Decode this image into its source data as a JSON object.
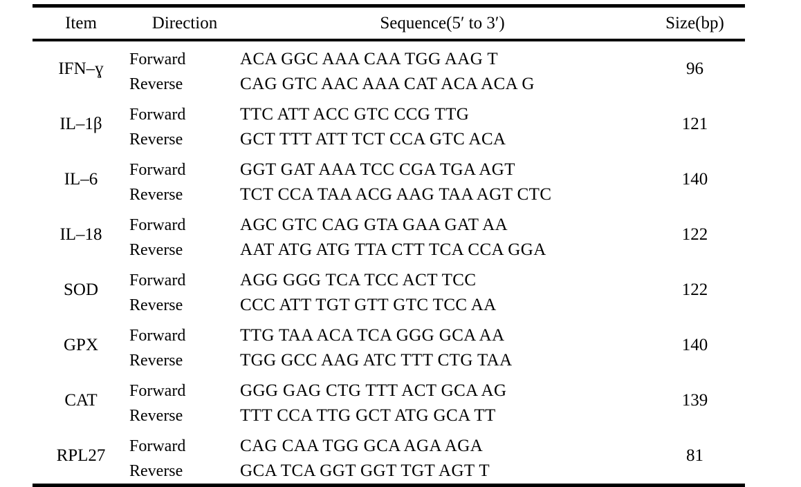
{
  "table": {
    "columns": [
      {
        "key": "item",
        "label": "Item"
      },
      {
        "key": "direction",
        "label": "Direction"
      },
      {
        "key": "sequence",
        "label": "Sequence(5′ to 3′)"
      },
      {
        "key": "size",
        "label": "Size(bp)"
      }
    ],
    "rows": [
      {
        "item": "IFN–ɣ",
        "size": "96",
        "forward_label": "Forward",
        "reverse_label": "Reverse",
        "forward_sequence": "ACA GGC AAA CAA TGG AAG T",
        "reverse_sequence": "CAG GTC AAC AAA CAT ACA ACA G"
      },
      {
        "item": "IL–1β",
        "size": "121",
        "forward_label": "Forward",
        "reverse_label": "Reverse",
        "forward_sequence": "TTC ATT ACC GTC CCG TTG",
        "reverse_sequence": "GCT TTT ATT TCT CCA GTC ACA"
      },
      {
        "item": "IL–6",
        "size": "140",
        "forward_label": "Forward",
        "reverse_label": "Reverse",
        "forward_sequence": "GGT GAT AAA TCC CGA TGA AGT",
        "reverse_sequence": "TCT CCA TAA ACG AAG TAA AGT CTC"
      },
      {
        "item": "IL–18",
        "size": "122",
        "forward_label": "Forward",
        "reverse_label": "Reverse",
        "forward_sequence": "AGC GTC CAG GTA GAA GAT AA",
        "reverse_sequence": "AAT ATG ATG TTA CTT TCA CCA GGA"
      },
      {
        "item": "SOD",
        "size": "122",
        "forward_label": "Forward",
        "reverse_label": "Reverse",
        "forward_sequence": "AGG GGG TCA TCC ACT TCC",
        "reverse_sequence": "CCC ATT TGT GTT GTC TCC AA"
      },
      {
        "item": "GPX",
        "size": "140",
        "forward_label": "Forward",
        "reverse_label": "Reverse",
        "forward_sequence": "TTG TAA ACA TCA GGG GCA AA",
        "reverse_sequence": "TGG GCC AAG ATC TTT CTG TAA"
      },
      {
        "item": "CAT",
        "size": "139",
        "forward_label": "Forward",
        "reverse_label": "Reverse",
        "forward_sequence": "GGG GAG CTG TTT ACT GCA AG",
        "reverse_sequence": "TTT CCA TTG GCT ATG GCA TT"
      },
      {
        "item": "RPL27",
        "size": "81",
        "forward_label": "Forward",
        "reverse_label": "Reverse",
        "forward_sequence": "CAG CAA TGG GCA AGA AGA",
        "reverse_sequence": "GCA TCA GGT GGT TGT AGT T"
      }
    ]
  }
}
